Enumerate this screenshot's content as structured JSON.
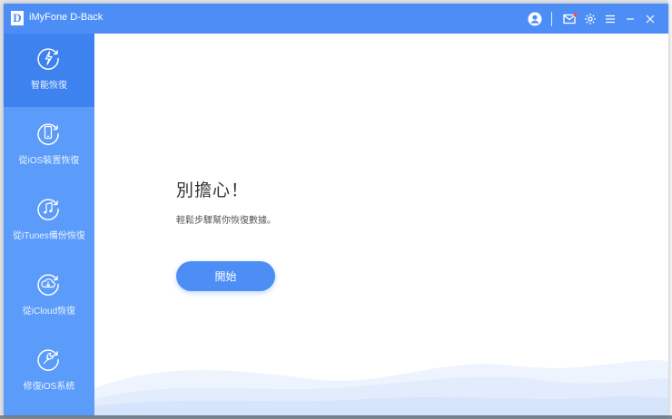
{
  "window": {
    "title": "iMyFone D-Back",
    "logo_letter": "D"
  },
  "titlebar_icons": [
    "account-icon",
    "mail-icon",
    "settings-icon",
    "menu-icon",
    "minimize-icon",
    "close-icon"
  ],
  "sidebar": {
    "items": [
      {
        "label": "智能恢復",
        "icon": "smart-recovery-icon",
        "active": true
      },
      {
        "label": "從iOS裝置恢復",
        "icon": "ios-device-icon",
        "active": false
      },
      {
        "label": "從iTunes備份恢復",
        "icon": "itunes-icon",
        "active": false
      },
      {
        "label": "從iCloud恢復",
        "icon": "icloud-icon",
        "active": false
      },
      {
        "label": "修復iOS系統",
        "icon": "repair-icon",
        "active": false
      }
    ]
  },
  "main": {
    "heading": "別擔心！",
    "subtext": "輕鬆步驟幫你恢復數據。",
    "start_button": "開始"
  },
  "colors": {
    "accent": "#4d8ef6",
    "sidebar": "#5b9bfa",
    "sidebar_active": "#3d82ee"
  }
}
